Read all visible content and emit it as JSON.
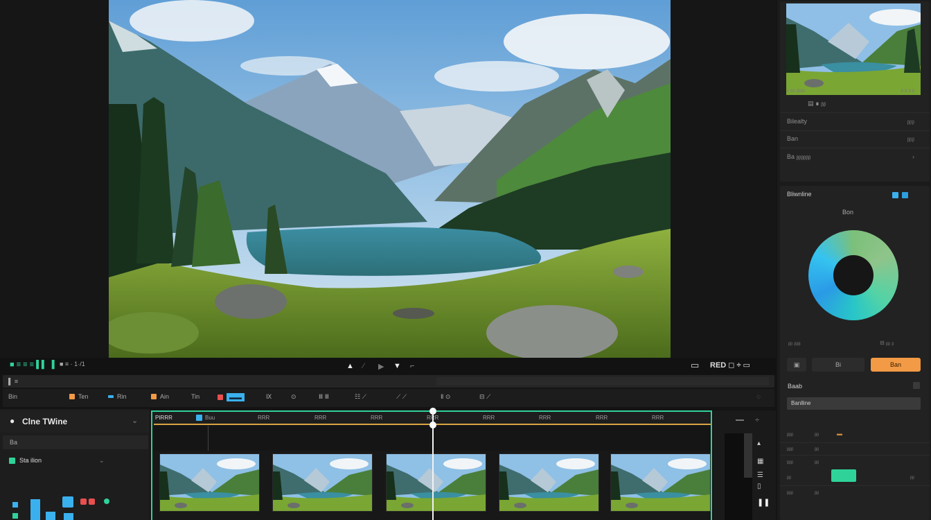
{
  "transport": {
    "left_label": "■ ≡ ≡ ≡ ▌▌ ▐",
    "left_time": "■ ≡ · 1·/1",
    "right_label": "RED ◻ ÷ ▭"
  },
  "toolbar": {
    "row1_left": "▌ ≡",
    "row2_items": [
      "Bin",
      "Ten",
      "Rin",
      "Ain",
      "Tin",
      "▬▬",
      "Ⅸ",
      "⊙",
      "Ⅲ Ⅲ",
      "☷ ⟋",
      "⟋ ⟋",
      "Ⅱ ⊙",
      "⊟ ⟋"
    ]
  },
  "left_panel": {
    "title": "Clne TWine",
    "sub1": "Ba",
    "sub2": "Sta ilion"
  },
  "timeline": {
    "ruler_labels": [
      "PIRRR",
      "Buu",
      "RRR",
      "RRR",
      "RRR",
      "RRR",
      "RRR",
      "RRR",
      "RRR",
      "RRR"
    ],
    "clip_count": 5
  },
  "right_panel": {
    "thumb_caption_left": "ᵦ ᵦᵦ ᵦᵦᵦᵦ",
    "thumb_caption_right": "ᵦ ᵦ ᵦ ᵦ",
    "row_a": "▤ ∎ ᵦᵦ",
    "prop1_label": "Bilealty",
    "prop1_value": "ᵦᵦᵦ",
    "prop2_label": "Ban",
    "prop2_value": "ᵦᵦᵦ",
    "prop3_label": "Ba ᵦᵦᵦᵦᵦᵦ",
    "color_title": "Bliwnline",
    "color_subtitle": "Bon",
    "bottom_left": "ᵦᵦ ᵦᵦᵦ",
    "bottom_right": "⊟ ᵦᵦ ᵦ",
    "btn_a": "▣",
    "btn_b": "Bi",
    "btn_orange": "Ban",
    "section_title": "Baab",
    "selected_row": "Banlline",
    "rows": [
      {
        "label": "ᵦᵦᵦ",
        "value": "ᵦᵦ"
      },
      {
        "label": "ᵦᵦᵦ",
        "value": "ᵦᵦ"
      },
      {
        "label": "ᵦᵦᵦ",
        "value": "ᵦᵦ"
      },
      {
        "label": "ᵦᵦ",
        "value": "ᵦᵦ"
      },
      {
        "label": "ᵦᵦᵦ",
        "value": "ᵦᵦ"
      }
    ]
  },
  "colors": {
    "accent_green": "#2fd39a",
    "accent_orange": "#f29a45",
    "accent_blue": "#3bb0ee",
    "timeline_orange": "#d9a442"
  }
}
